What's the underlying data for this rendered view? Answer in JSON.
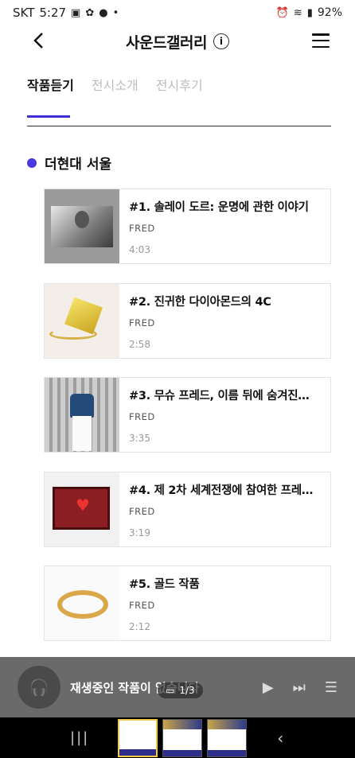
{
  "status_bar": {
    "carrier": "SKT",
    "time": "5:27",
    "battery": "92%",
    "icons": [
      "gallery-icon",
      "wind-icon",
      "chat-icon",
      "alarm-icon",
      "wifi-icon",
      "signal-icon"
    ]
  },
  "header": {
    "title": "사운드갤러리",
    "info_icon": "info-icon",
    "back_icon": "back-icon",
    "menu_icon": "hamburger-menu-icon"
  },
  "tabs": [
    {
      "label": "작품듣기",
      "active": true
    },
    {
      "label": "전시소개",
      "active": false
    },
    {
      "label": "전시후기",
      "active": false
    }
  ],
  "section": {
    "title": "더현대 서울",
    "accent": "#4a38e0"
  },
  "tracks": [
    {
      "title": "#1. 솔레이 도르: 운명에 관한 이야기",
      "artist": "FRED",
      "duration": "4:03"
    },
    {
      "title": "#2. 진귀한 다이아몬드의 4C",
      "artist": "FRED",
      "duration": "2:58"
    },
    {
      "title": "#3. 무슈 프레드, 이름 뒤에 숨겨진…",
      "artist": "FRED",
      "duration": "3:35"
    },
    {
      "title": "#4. 제 2차 세계전쟁에 참여한 프레…",
      "artist": "FRED",
      "duration": "3:19"
    },
    {
      "title": "#5. 골드 작품",
      "artist": "FRED",
      "duration": "2:12"
    }
  ],
  "player": {
    "status_text": "재생중인 작품이 없습니다",
    "controls": [
      "play-icon",
      "next-icon",
      "playlist-icon"
    ]
  },
  "page_indicator": "1/3"
}
